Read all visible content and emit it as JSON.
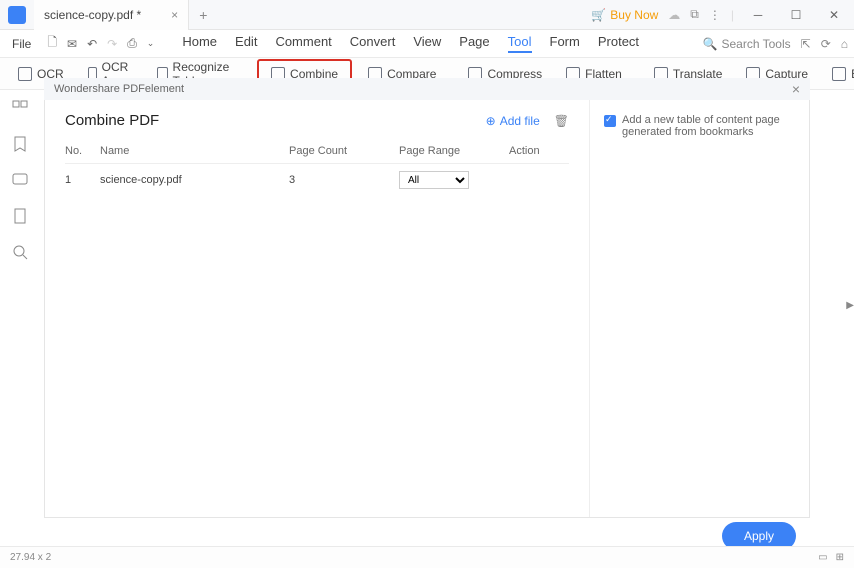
{
  "titlebar": {
    "file_name": "science-copy.pdf *",
    "buy_now": "Buy Now"
  },
  "menu": {
    "file": "File",
    "items": [
      "Home",
      "Edit",
      "Comment",
      "Convert",
      "View",
      "Page",
      "Tool",
      "Form",
      "Protect"
    ],
    "active": "Tool",
    "search_placeholder": "Search Tools"
  },
  "toolbar": {
    "ocr": "OCR",
    "ocr_area": "OCR Area",
    "recognize_table": "Recognize Table",
    "combine": "Combine",
    "compare": "Compare",
    "compress": "Compress",
    "flatten": "Flatten",
    "translate": "Translate",
    "capture": "Capture",
    "batch": "Ba"
  },
  "panel": {
    "header": "Wondershare PDFelement",
    "title": "Combine PDF",
    "add_file": "Add file",
    "columns": {
      "no": "No.",
      "name": "Name",
      "count": "Page Count",
      "range": "Page Range",
      "action": "Action"
    },
    "rows": [
      {
        "no": "1",
        "name": "science-copy.pdf",
        "count": "3",
        "range": "All"
      }
    ],
    "option_label": "Add a new table of content page generated from bookmarks",
    "apply": "Apply"
  },
  "status": {
    "dims": "27.94 x 2"
  }
}
